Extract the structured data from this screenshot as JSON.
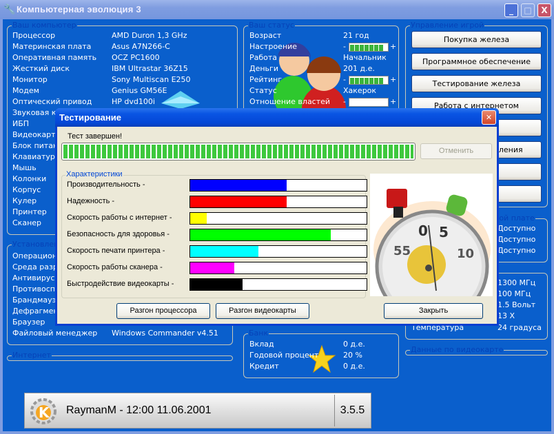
{
  "app": {
    "title": "Компьютерная эволюция 3"
  },
  "computer": {
    "title": "Ваш компьютер",
    "items": [
      {
        "label": "Процессор",
        "value": "AMD Duron 1,3 GHz"
      },
      {
        "label": "Материнская плата",
        "value": "Asus A7N266-C"
      },
      {
        "label": "Оперативная память",
        "value": "OCZ PC1600"
      },
      {
        "label": "Жесткий диск",
        "value": "IBM Ultrastar 36Z15"
      },
      {
        "label": "Монитор",
        "value": "Sony Multiscan E250"
      },
      {
        "label": "Модем",
        "value": "Genius GM56E"
      },
      {
        "label": "Оптический привод",
        "value": "HP dvd100i"
      },
      {
        "label": "Звуковая карта",
        "value": ""
      },
      {
        "label": "ИБП",
        "value": ""
      },
      {
        "label": "Видеокарта",
        "value": ""
      },
      {
        "label": "Блок питания",
        "value": ""
      },
      {
        "label": "Клавиатура",
        "value": ""
      },
      {
        "label": "Мышь",
        "value": ""
      },
      {
        "label": "Колонки",
        "value": ""
      },
      {
        "label": "Корпус",
        "value": ""
      },
      {
        "label": "Кулер",
        "value": ""
      },
      {
        "label": "Принтер",
        "value": ""
      },
      {
        "label": "Сканер",
        "value": ""
      }
    ]
  },
  "software": {
    "title": "Установленные программы",
    "items": [
      {
        "label": "Операционная система",
        "value": ""
      },
      {
        "label": "Среда разработки",
        "value": ""
      },
      {
        "label": "Антивирус",
        "value": ""
      },
      {
        "label": "Противоспам",
        "value": ""
      },
      {
        "label": "Брандмауэр",
        "value": ""
      },
      {
        "label": "Дефрагментатор",
        "value": ""
      },
      {
        "label": "Браузер",
        "value": ""
      },
      {
        "label": "Файловый менеджер",
        "value": "Windows Commander v4.51"
      }
    ]
  },
  "internet": {
    "title": "Интернет"
  },
  "status": {
    "title": "Ваш статус",
    "age_label": "Возраст",
    "age": "21 год",
    "mood_label": "Настроение",
    "mood_level": 7,
    "job_label": "Работа",
    "job": "Начальник",
    "money_label": "Деньги",
    "money": "201 д.е.",
    "rating_label": "Рейтинг",
    "rating_level": 7,
    "status_label": "Статус",
    "status": "Хакерок",
    "authorities_label": "Отношение властей",
    "authorities_level": 0,
    "minus": "-",
    "plus": "+"
  },
  "bank": {
    "title": "Банк",
    "deposit_label": "Вклад",
    "deposit": "0 д.е.",
    "rate_label": "Годовой процент",
    "rate": "20 %",
    "credit_label": "Кредит",
    "credit": "0 д.е."
  },
  "game": {
    "title": "Управление игрой",
    "buttons": [
      "Покупка железа",
      "Программное обеспечение",
      "Тестирование железа",
      "Работа с интернетом",
      "",
      "Настройки управления",
      "",
      ""
    ]
  },
  "motherboard": {
    "title": "Данные по материнской плате",
    "values": [
      "Доступно",
      "Доступно",
      "Доступно"
    ]
  },
  "cpu": {
    "values": [
      "1300 МГц",
      "100 МГц",
      "1.5 Вольт",
      "13 X"
    ],
    "temp_label": "Температура",
    "temp": "24 градуса"
  },
  "video": {
    "title": "Данные по видеокарте"
  },
  "statusbar": {
    "text": "RaymanM - 12:00 11.06.2001",
    "version": "3.5.5"
  },
  "dialog": {
    "title": "Тестирование",
    "message": "Тест завершен!",
    "progress": 1.0,
    "cancel": "Отменить",
    "group": "Характеристики",
    "metrics": [
      {
        "label": "Производительность -",
        "value": 0.545,
        "color": "#0000ff"
      },
      {
        "label": "Надежность -",
        "value": 0.545,
        "color": "#ff0000"
      },
      {
        "label": "Скорость работы с интернет -",
        "value": 0.095,
        "color": "#ffff00"
      },
      {
        "label": "Безопасность для здоровья -",
        "value": 0.795,
        "color": "#00ff00"
      },
      {
        "label": "Скорость печати принтера -",
        "value": 0.385,
        "color": "#00ffff"
      },
      {
        "label": "Скорость работы сканера -",
        "value": 0.25,
        "color": "#ff00ff"
      },
      {
        "label": "Быстродействие видеокарты -",
        "value": 0.295,
        "color": "#000000"
      }
    ],
    "overclock_cpu": "Разгон процессора",
    "overclock_gpu": "Разгон видеокарты",
    "close": "Закрыть"
  }
}
